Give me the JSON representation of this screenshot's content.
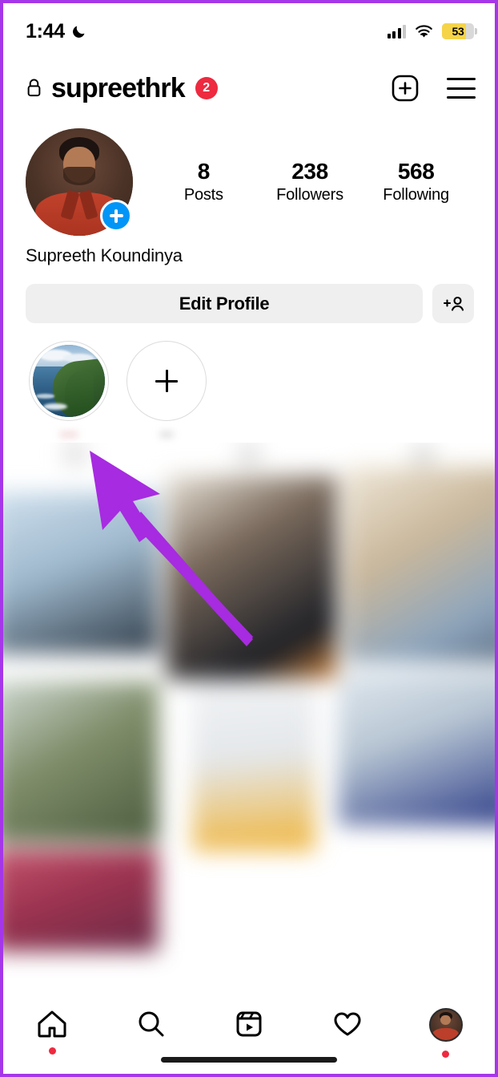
{
  "status_bar": {
    "time": "1:44",
    "dnd_icon": "moon-icon",
    "signal_icon": "cellular-signal-icon",
    "wifi_icon": "wifi-icon",
    "battery_percent": "53",
    "battery_level": 53,
    "battery_color": "#F5D44A"
  },
  "header": {
    "lock_icon": "lock-icon",
    "username": "supreethrk",
    "badge_count": "2",
    "badge_color": "#ED2A3F",
    "create_icon": "plus-box-icon",
    "menu_icon": "hamburger-menu-icon"
  },
  "profile": {
    "avatar_alt": "profile-photo",
    "add_story_icon": "plus-icon",
    "add_story_color": "#0095F6",
    "full_name": "Supreeth Koundinya",
    "stats": [
      {
        "value": "8",
        "label": "Posts"
      },
      {
        "value": "238",
        "label": "Followers"
      },
      {
        "value": "568",
        "label": "Following"
      }
    ]
  },
  "actions": {
    "edit_profile_label": "Edit Profile",
    "add_person_icon": "add-person-icon",
    "button_bg": "#EFEFEF"
  },
  "highlights": [
    {
      "type": "story",
      "thumbnail": "coastal-cliff-photo",
      "label": ""
    },
    {
      "type": "new",
      "icon": "plus-icon",
      "label": ""
    }
  ],
  "posts_grid": {
    "blurred": true,
    "tabs": [
      "grid-tab",
      "reels-tab",
      "tagged-tab"
    ]
  },
  "annotation": {
    "arrow_color": "#A72BE0",
    "points_to": "story-highlight-thumbnail"
  },
  "bottom_nav": {
    "items": [
      {
        "name": "home",
        "icon": "home-icon",
        "has_dot": true
      },
      {
        "name": "search",
        "icon": "search-icon",
        "has_dot": false
      },
      {
        "name": "reels",
        "icon": "reels-icon",
        "has_dot": false
      },
      {
        "name": "activity",
        "icon": "heart-icon",
        "has_dot": false
      },
      {
        "name": "profile",
        "icon": "profile-avatar-icon",
        "has_dot": true
      }
    ],
    "dot_color": "#ED2A3F"
  },
  "frame": {
    "border_color": "#A537E8"
  }
}
